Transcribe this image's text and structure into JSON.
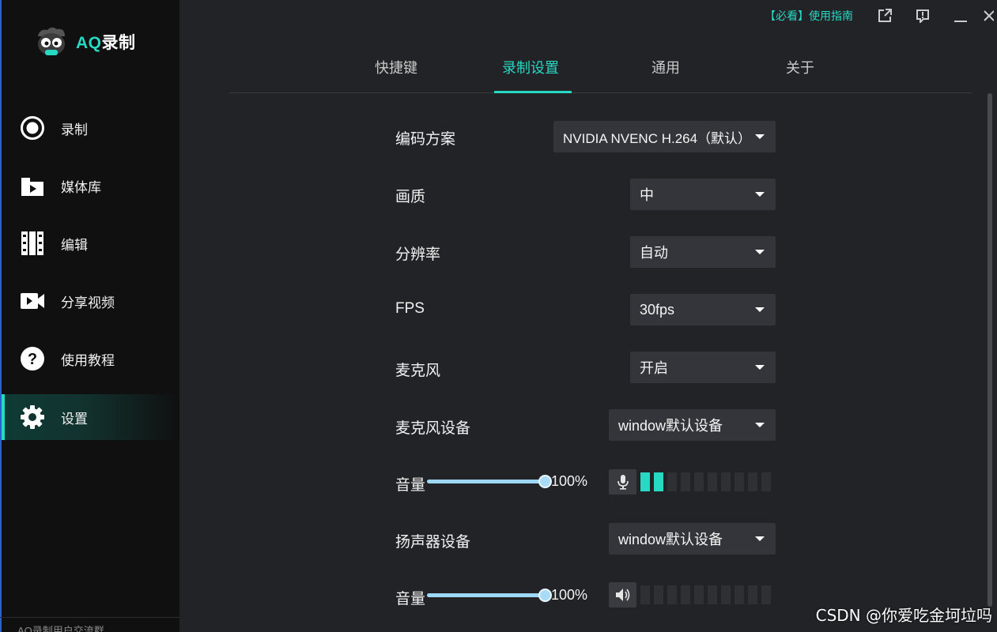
{
  "app": {
    "brand_prefix": "AQ",
    "brand_suffix": "录制"
  },
  "sidebar": {
    "items": [
      {
        "label": "录制",
        "icon": "record-icon"
      },
      {
        "label": "媒体库",
        "icon": "media-library-icon"
      },
      {
        "label": "编辑",
        "icon": "edit-film-icon"
      },
      {
        "label": "分享视频",
        "icon": "video-camera-icon"
      },
      {
        "label": "使用教程",
        "icon": "help-icon"
      },
      {
        "label": "设置",
        "icon": "gear-icon",
        "active": true
      }
    ],
    "group_text": "AQ录制用户交流群"
  },
  "titlebar": {
    "guide_label": "【必看】使用指南",
    "icons": [
      "external-link-icon",
      "feedback-icon",
      "minimize-icon",
      "close-icon"
    ]
  },
  "tabs": [
    {
      "label": "快捷键"
    },
    {
      "label": "录制设置",
      "active": true
    },
    {
      "label": "通用"
    },
    {
      "label": "关于"
    }
  ],
  "settings": {
    "encoding": {
      "label": "编码方案",
      "value": "NVIDIA NVENC H.264（默认）"
    },
    "quality": {
      "label": "画质",
      "value": "中"
    },
    "resolution": {
      "label": "分辨率",
      "value": "自动"
    },
    "fps": {
      "label": "FPS",
      "value": "30fps"
    },
    "microphone": {
      "label": "麦克风",
      "value": "开启"
    },
    "mic_device": {
      "label": "麦克风设备",
      "value": "window默认设备"
    },
    "mic_volume": {
      "label": "音量",
      "value_text": "100%",
      "level": 1.0,
      "meter_active": 2,
      "meter_total": 10
    },
    "speaker_device": {
      "label": "扬声器设备",
      "value": "window默认设备"
    },
    "speaker_volume": {
      "label": "音量",
      "value_text": "100%",
      "level": 1.0,
      "meter_active": 0,
      "meter_total": 10
    }
  },
  "colors": {
    "accent": "#27d9c3",
    "sidebar_bg": "#101010",
    "content_bg": "#222326",
    "dropdown_bg": "#34353a"
  },
  "watermark": "CSDN @你爱吃金坷垃吗"
}
